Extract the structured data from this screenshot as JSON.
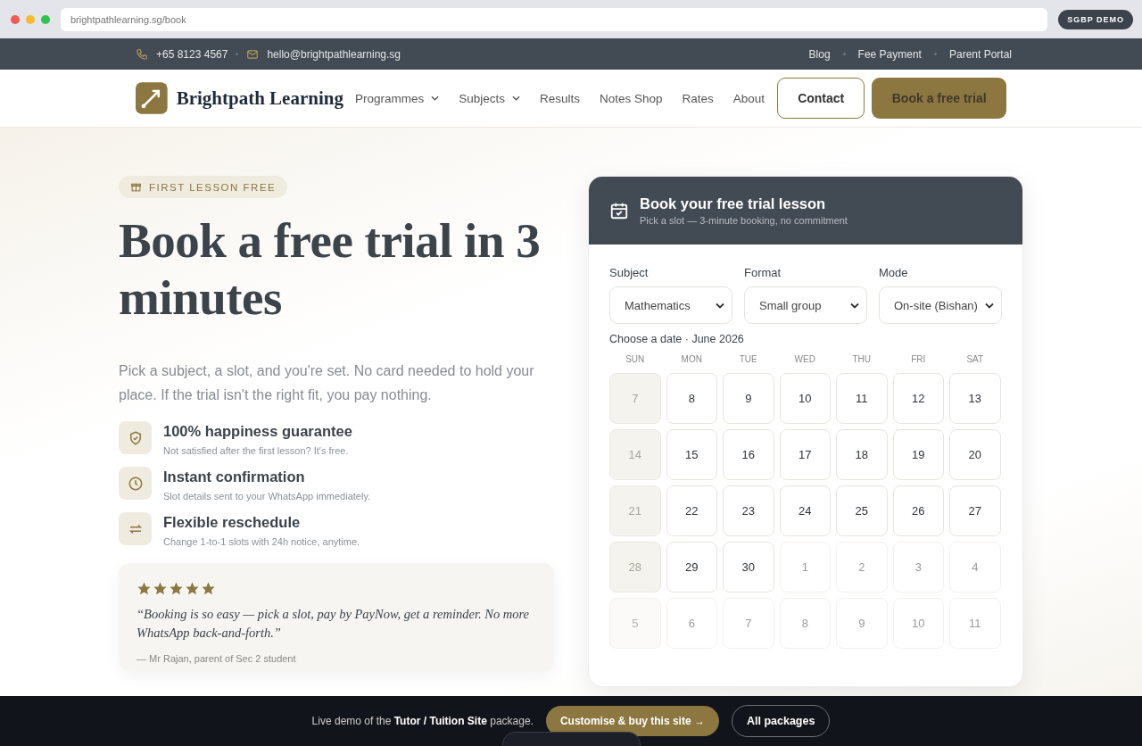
{
  "browser": {
    "url": "brightpathlearning.sg/book",
    "badge": "SGBP DEMO"
  },
  "topbar": {
    "phone": "+65 8123 4567",
    "email": "hello@brightpathlearning.sg",
    "links": [
      "Blog",
      "Fee Payment",
      "Parent Portal"
    ]
  },
  "nav": {
    "brand": "Brightpath Learning",
    "items": [
      {
        "label": "Programmes",
        "dropdown": true
      },
      {
        "label": "Subjects",
        "dropdown": true
      },
      {
        "label": "Results",
        "dropdown": false
      },
      {
        "label": "Notes Shop",
        "dropdown": false
      },
      {
        "label": "Rates",
        "dropdown": false
      },
      {
        "label": "About",
        "dropdown": false
      }
    ],
    "contact": "Contact",
    "cta": "Book a free trial"
  },
  "hero": {
    "badge": "FIRST LESSON FREE",
    "title": "Book a free trial in 3 minutes",
    "lead": "Pick a subject, a slot, and you're set. No card needed to hold your place. If the trial isn't the right fit, you pay nothing.",
    "features": [
      {
        "title": "100% happiness guarantee",
        "text": "Not satisfied after the first lesson? It's free."
      },
      {
        "title": "Instant confirmation",
        "text": "Slot details sent to your WhatsApp immediately."
      },
      {
        "title": "Flexible reschedule",
        "text": "Change 1-to-1 slots with 24h notice, anytime."
      }
    ],
    "testimonial": {
      "stars": 5,
      "quote": "“Booking is so easy — pick a slot, pay by PayNow, get a reminder. No more WhatsApp back-and-forth.”",
      "author": "— Mr Rajan, parent of Sec 2 student"
    }
  },
  "booking": {
    "title": "Book your free trial lesson",
    "subtitle": "Pick a slot — 3-minute booking, no commitment",
    "fields": [
      {
        "label": "Subject",
        "value": "Mathematics"
      },
      {
        "label": "Format",
        "value": "Small group"
      },
      {
        "label": "Mode",
        "value": "On-site (Bishan)"
      }
    ],
    "date_label": "Choose a date · June 2026",
    "weekdays": [
      "SUN",
      "MON",
      "TUE",
      "WED",
      "THU",
      "FRI",
      "SAT"
    ],
    "days": [
      {
        "label": "7",
        "kind": "closed"
      },
      {
        "label": "8",
        "kind": "open"
      },
      {
        "label": "9",
        "kind": "open"
      },
      {
        "label": "10",
        "kind": "open"
      },
      {
        "label": "11",
        "kind": "open"
      },
      {
        "label": "12",
        "kind": "open"
      },
      {
        "label": "13",
        "kind": "open"
      },
      {
        "label": "14",
        "kind": "closed"
      },
      {
        "label": "15",
        "kind": "open"
      },
      {
        "label": "16",
        "kind": "open"
      },
      {
        "label": "17",
        "kind": "open"
      },
      {
        "label": "18",
        "kind": "open"
      },
      {
        "label": "19",
        "kind": "open"
      },
      {
        "label": "20",
        "kind": "open"
      },
      {
        "label": "21",
        "kind": "closed"
      },
      {
        "label": "22",
        "kind": "open"
      },
      {
        "label": "23",
        "kind": "open"
      },
      {
        "label": "24",
        "kind": "open"
      },
      {
        "label": "25",
        "kind": "open"
      },
      {
        "label": "26",
        "kind": "open"
      },
      {
        "label": "27",
        "kind": "open"
      },
      {
        "label": "28",
        "kind": "closed"
      },
      {
        "label": "29",
        "kind": "open"
      },
      {
        "label": "30",
        "kind": "open"
      },
      {
        "label": "1",
        "kind": "next"
      },
      {
        "label": "2",
        "kind": "next"
      },
      {
        "label": "3",
        "kind": "next"
      },
      {
        "label": "4",
        "kind": "next"
      },
      {
        "label": "5",
        "kind": "next-closed"
      },
      {
        "label": "6",
        "kind": "next"
      },
      {
        "label": "7",
        "kind": "next"
      },
      {
        "label": "8",
        "kind": "next"
      },
      {
        "label": "9",
        "kind": "next"
      },
      {
        "label": "10",
        "kind": "next"
      },
      {
        "label": "11",
        "kind": "next"
      }
    ]
  },
  "demo_bar": {
    "text": "Live demo of the **Tutor / Tuition Site** package.",
    "buy": "Customise & buy this site →",
    "packages": "All packages"
  }
}
